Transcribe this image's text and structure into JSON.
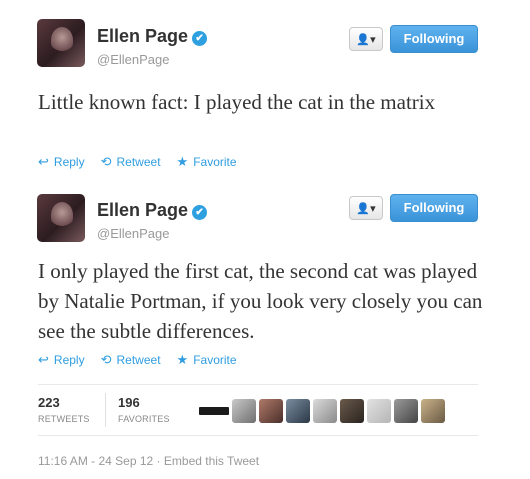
{
  "tweets": [
    {
      "user": {
        "name": "Ellen Page",
        "handle": "@EllenPage",
        "verified": true
      },
      "follow_label": "Following",
      "user_menu_label": "▾",
      "text": "Little known fact: I played the cat in the matrix",
      "actions": {
        "reply": "Reply",
        "retweet": "Retweet",
        "favorite": "Favorite"
      }
    },
    {
      "user": {
        "name": "Ellen Page",
        "handle": "@EllenPage",
        "verified": true
      },
      "follow_label": "Following",
      "user_menu_label": "▾",
      "text": "I only played the first cat, the second cat was played by Natalie Portman, if you look very closely you can see the subtle differences.",
      "actions": {
        "reply": "Reply",
        "retweet": "Retweet",
        "favorite": "Favorite"
      }
    }
  ],
  "stats": {
    "retweets": {
      "count": "223",
      "label": "RETWEETS"
    },
    "favorites": {
      "count": "196",
      "label": "FAVORITES"
    }
  },
  "footer": {
    "timestamp": "11:16 AM - 24 Sep 12",
    "separator": "·",
    "embed": "Embed this Tweet"
  },
  "colors": {
    "accent": "#2f9de0",
    "follow_button": "#3a93d8",
    "text": "#333333",
    "muted": "#999999"
  },
  "icons": [
    "reply-icon",
    "retweet-icon",
    "star-icon",
    "user-icon",
    "verified-icon"
  ]
}
